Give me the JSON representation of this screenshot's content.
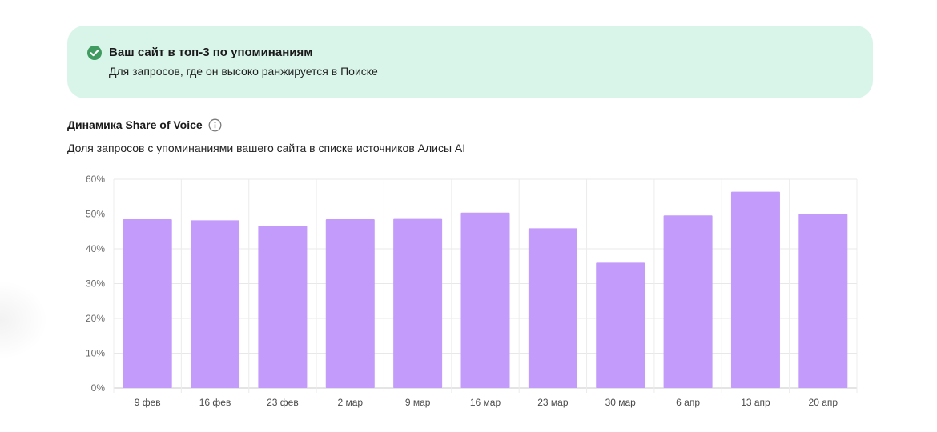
{
  "banner": {
    "title": "Ваш сайт в топ-3 по упоминаниям",
    "subtitle": "Для запросов, где он высоко ранжируется в Поиске",
    "icon": "check-circle-icon",
    "accent_color": "#3f9b5f",
    "background_color": "#d9f5ea"
  },
  "section": {
    "title": "Динамика Share of Voice",
    "info_icon": "info-icon",
    "subtitle": "Доля запросов с упоминаниями вашего сайта в списке источников Алисы AI"
  },
  "chart_data": {
    "type": "bar",
    "categories": [
      "9 фев",
      "16 фев",
      "23 фев",
      "2 мар",
      "9 мар",
      "16 мар",
      "23 мар",
      "30 мар",
      "6 апр",
      "13 апр",
      "20 апр"
    ],
    "values": [
      48.5,
      48.2,
      46.6,
      48.5,
      48.6,
      50.4,
      45.9,
      36.0,
      49.6,
      56.4,
      50.0
    ],
    "ylim": [
      0,
      60
    ],
    "yticks": [
      0,
      10,
      20,
      30,
      40,
      50,
      60
    ],
    "ytick_labels": [
      "0%",
      "10%",
      "20%",
      "30%",
      "40%",
      "50%",
      "60%"
    ],
    "grid": true,
    "bar_color": "#c29bfb",
    "title": "",
    "xlabel": "",
    "ylabel": ""
  }
}
